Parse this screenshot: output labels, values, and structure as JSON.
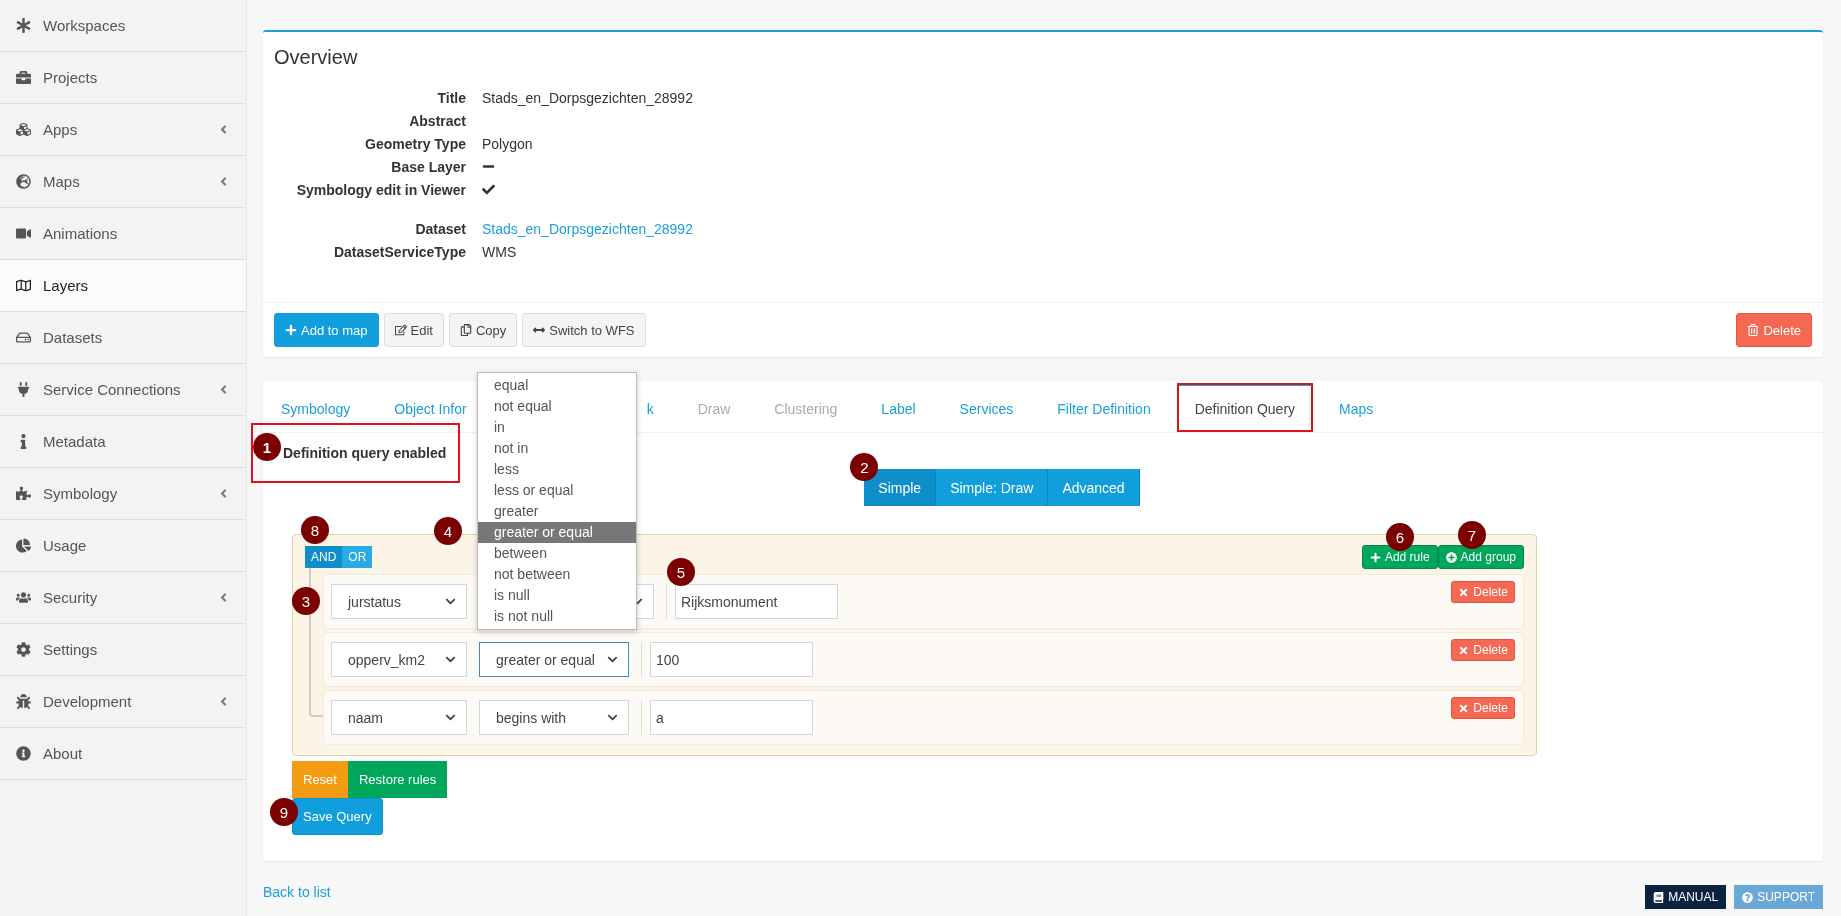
{
  "sidebar": {
    "items": [
      {
        "label": "Workspaces",
        "selected": false,
        "expandable": false
      },
      {
        "label": "Projects",
        "selected": false,
        "expandable": false
      },
      {
        "label": "Apps",
        "selected": false,
        "expandable": true
      },
      {
        "label": "Maps",
        "selected": false,
        "expandable": true
      },
      {
        "label": "Animations",
        "selected": false,
        "expandable": false
      },
      {
        "label": "Layers",
        "selected": true,
        "expandable": false
      },
      {
        "label": "Datasets",
        "selected": false,
        "expandable": false
      },
      {
        "label": "Service Connections",
        "selected": false,
        "expandable": true
      },
      {
        "label": "Metadata",
        "selected": false,
        "expandable": false
      },
      {
        "label": "Symbology",
        "selected": false,
        "expandable": true
      },
      {
        "label": "Usage",
        "selected": false,
        "expandable": false
      },
      {
        "label": "Security",
        "selected": false,
        "expandable": true
      },
      {
        "label": "Settings",
        "selected": false,
        "expandable": false
      },
      {
        "label": "Development",
        "selected": false,
        "expandable": true
      },
      {
        "label": "About",
        "selected": false,
        "expandable": false
      }
    ]
  },
  "overview": {
    "title": "Overview",
    "properties": [
      {
        "label": "Title",
        "kind": "text",
        "value": "Stads_en_Dorpsgezichten_28992"
      },
      {
        "label": "Abstract",
        "kind": "text"
      },
      {
        "label": "Geometry Type",
        "kind": "text",
        "value": "Polygon"
      },
      {
        "label": "Base Layer",
        "kind": "flag",
        "on": false
      },
      {
        "label": "Symbology edit in Viewer",
        "kind": "flag",
        "on": true
      }
    ],
    "dataset_properties": [
      {
        "label": "Dataset",
        "kind": "link",
        "value": "Stads_en_Dorpsgezichten_28992"
      },
      {
        "label": "DatasetServiceType",
        "kind": "text",
        "value": "WMS"
      }
    ],
    "actions": [
      {
        "label": "Add to map",
        "kind": "primary"
      },
      {
        "label": "Edit",
        "kind": "edit"
      },
      {
        "label": "Copy",
        "kind": "copy"
      },
      {
        "label": "Switch to WFS",
        "kind": "switch"
      }
    ],
    "delete_button": "Delete"
  },
  "tabs": [
    {
      "label": "Symbology",
      "selected": false,
      "disabled": false,
      "highlighted": false
    },
    {
      "label": "Object Infor",
      "selected": false,
      "disabled": false,
      "highlighted": false
    },
    {
      "label": "k",
      "selected": false,
      "disabled": false,
      "highlighted": false
    },
    {
      "label": "Draw",
      "selected": false,
      "disabled": true,
      "highlighted": false
    },
    {
      "label": "Clustering",
      "selected": false,
      "disabled": true,
      "highlighted": false
    },
    {
      "label": "Label",
      "selected": false,
      "disabled": false,
      "highlighted": false
    },
    {
      "label": "Services",
      "selected": false,
      "disabled": false,
      "highlighted": false
    },
    {
      "label": "Filter Definition",
      "selected": false,
      "disabled": false,
      "highlighted": false
    },
    {
      "label": "Definition Query",
      "selected": true,
      "disabled": false,
      "highlighted": true
    },
    {
      "label": "Maps",
      "selected": false,
      "disabled": false,
      "highlighted": false
    }
  ],
  "status": {
    "text": "Definition query enabled",
    "marker": "1",
    "highlighted": true
  },
  "modes": {
    "marker": "2",
    "buttons": [
      {
        "label": "Simple",
        "selected": true
      },
      {
        "label": "Simple: Draw",
        "selected": false
      },
      {
        "label": "Advanced",
        "selected": false
      }
    ]
  },
  "query_builder": {
    "conditions": {
      "marker": "8",
      "buttons": [
        {
          "label": "AND",
          "selected": true
        },
        {
          "label": "OR",
          "selected": false
        }
      ]
    },
    "add_rule": {
      "label": "Add rule",
      "marker": "6"
    },
    "add_group": {
      "label": "Add group",
      "marker": "7"
    },
    "rules": [
      {
        "field": "jurstatus",
        "value": "Rijksmonument",
        "field_marker": "3",
        "value_marker": "5",
        "delete": "Delete"
      },
      {
        "field": "opperv_km2",
        "operator": "greater or equal",
        "value": "100",
        "focused": true,
        "delete": "Delete"
      },
      {
        "field": "naam",
        "operator": "begins with",
        "value": "a",
        "focused": false,
        "delete": "Delete"
      }
    ],
    "operator_menu": {
      "marker": "4",
      "options": [
        {
          "label": "equal",
          "selected": false
        },
        {
          "label": "not equal",
          "selected": false
        },
        {
          "label": "in",
          "selected": false
        },
        {
          "label": "not in",
          "selected": false
        },
        {
          "label": "less",
          "selected": false
        },
        {
          "label": "less or equal",
          "selected": false
        },
        {
          "label": "greater",
          "selected": false
        },
        {
          "label": "greater or equal",
          "selected": true
        },
        {
          "label": "between",
          "selected": false
        },
        {
          "label": "not between",
          "selected": false
        },
        {
          "label": "is null",
          "selected": false
        },
        {
          "label": "is not null",
          "selected": false
        }
      ]
    }
  },
  "query_actions": [
    {
      "label": "Reset",
      "kind": "warning"
    },
    {
      "label": "Restore rules",
      "kind": "success"
    }
  ],
  "save": {
    "label": "Save Query",
    "marker": "9"
  },
  "back_link": "Back to list",
  "footer_buttons": [
    {
      "label": "MANUAL",
      "kind": "manual"
    },
    {
      "label": "SUPPORT",
      "kind": "support"
    }
  ]
}
